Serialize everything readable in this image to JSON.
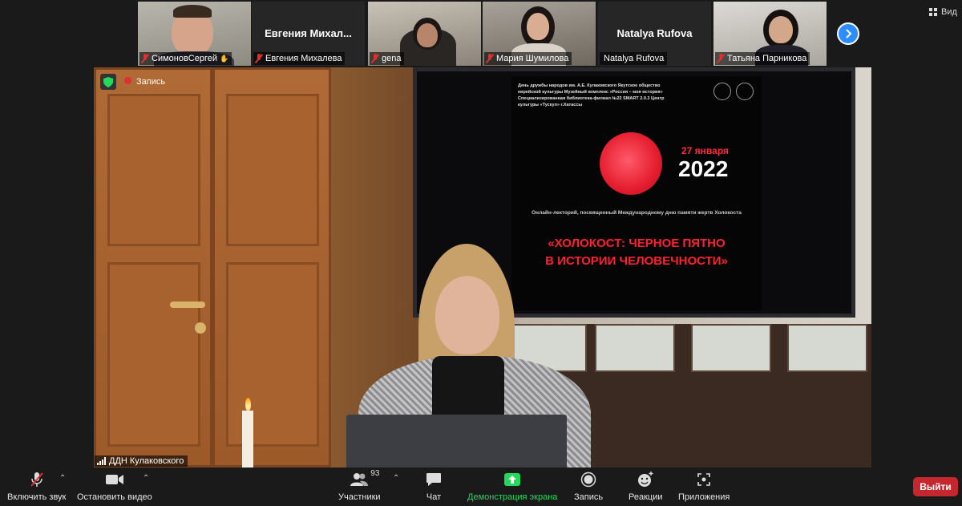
{
  "gallery": {
    "participants": [
      {
        "name": "СимоновСергей",
        "muted": true,
        "video": true
      },
      {
        "name": "Евгения Михалева",
        "display": "Евгения Михал...",
        "muted": true,
        "video": false
      },
      {
        "name": "gena",
        "muted": true,
        "video": true
      },
      {
        "name": "Мария Шумилова",
        "muted": true,
        "video": true
      },
      {
        "name": "Natalya Rufova",
        "display": "Natalya Rufova",
        "muted": false,
        "video": false
      },
      {
        "name": "Татьяна Парникова",
        "muted": true,
        "video": true
      }
    ],
    "view_label": "Вид"
  },
  "main": {
    "recording_label": "Запись",
    "speaker_name": "ДДН Кулаковского",
    "tv": {
      "small_text": "День дружбы народов им. А.Е. Кулаковского Якутское общество еврейской культуры Музейный комплекс «Россия – моя история» Специализированная библиотека-филиал №22 SMART 2.0.3 Центр культуры «Тускул» г.Хатассы",
      "date_line": "27 января",
      "year": "2022",
      "subtitle": "Онлайн-лекторий, посвященный Международному дню памяти жертв Холокоста",
      "title_line1": "«ХОЛОКОСТ: ЧЕРНОЕ ПЯТНО",
      "title_line2": "В ИСТОРИИ ЧЕЛОВЕЧНОСТИ»"
    }
  },
  "toolbar": {
    "unmute_label": "Включить звук",
    "stop_video_label": "Остановить видео",
    "participants_label": "Участники",
    "participants_count": "93",
    "chat_label": "Чат",
    "share_label": "Демонстрация экрана",
    "record_label": "Запись",
    "reactions_label": "Реакции",
    "apps_label": "Приложения",
    "exit_label": "Выйти"
  },
  "colors": {
    "accent_blue": "#2d8cff",
    "share_green": "#23d959",
    "exit_red": "#c6262e",
    "muted_red": "#e02f2f"
  }
}
